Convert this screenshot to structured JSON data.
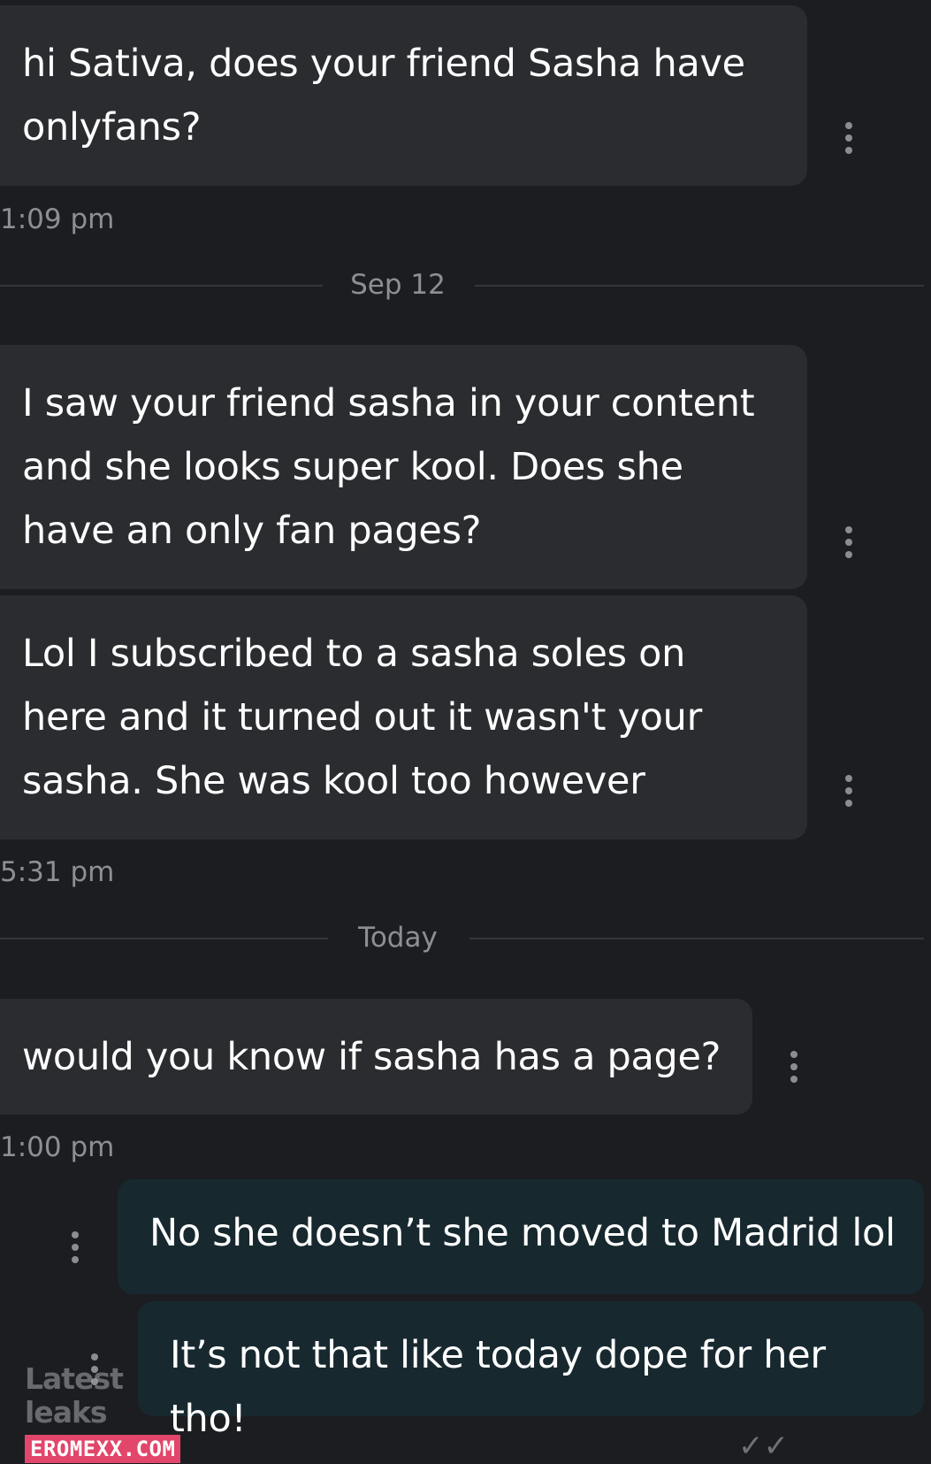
{
  "messages": [
    {
      "direction": "incoming",
      "text": "hi Sativa, does your friend Sasha have onlyfans?"
    },
    {
      "direction": "incoming",
      "text": "I saw your friend sasha in your content and she looks super kool. Does she have an only fan pages?"
    },
    {
      "direction": "incoming",
      "text": "Lol I subscribed to a sasha soles on here and it turned out it wasn't your sasha. She was kool too however"
    },
    {
      "direction": "incoming",
      "text": "would you know if sasha has a page?"
    },
    {
      "direction": "outgoing",
      "text": "No she doesn’t she moved to Madrid lol"
    },
    {
      "direction": "outgoing",
      "text": "It’s not that like today dope for her tho!"
    }
  ],
  "timestamps": {
    "t1": "1:09 pm",
    "t2": "5:31 pm",
    "t3": "1:00 pm"
  },
  "dividers": {
    "d1": "Sep 12",
    "d2": "Today"
  },
  "icons": {
    "message_menu": "more-vertical-icon",
    "status": "double-check-icon"
  },
  "watermark": {
    "title": "Latest leaks",
    "badge": "EROMEXX.COM"
  },
  "colors": {
    "background": "#1c1d21",
    "incoming_bubble": "#2b2c30",
    "outgoing_bubble": "#17292f",
    "text": "#ffffff",
    "muted": "#8d8f94",
    "badge": "#e2466a"
  }
}
